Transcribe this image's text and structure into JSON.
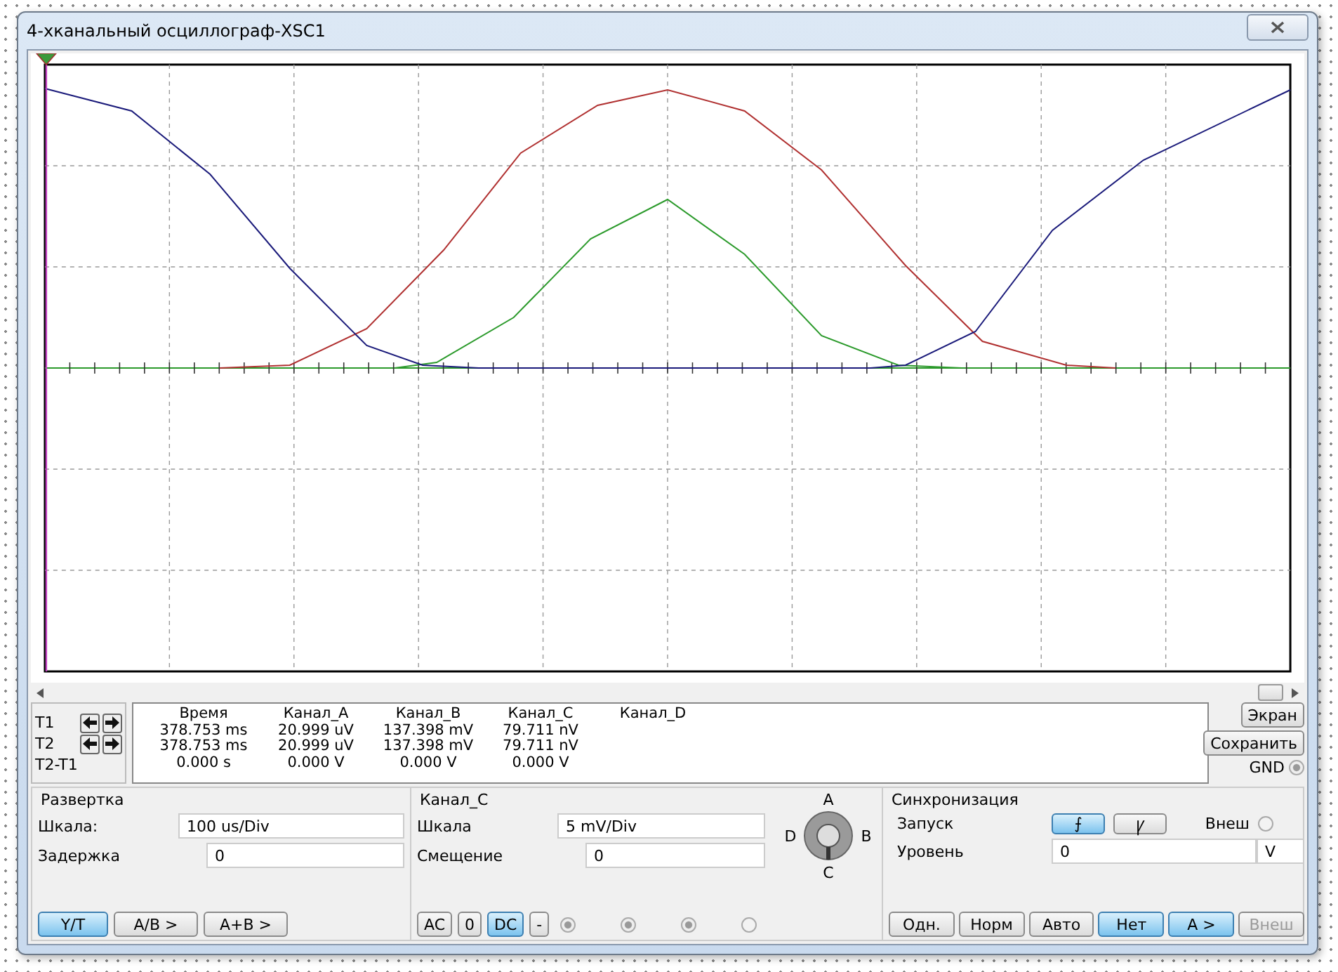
{
  "window": {
    "title": "4-хканальный осциллограф-XSC1"
  },
  "readout": {
    "row_labels": [
      "T1",
      "T2",
      "T2-T1"
    ],
    "columns": [
      {
        "header": "Время",
        "values": [
          "378.753 ms",
          "378.753 ms",
          "0.000 s"
        ]
      },
      {
        "header": "Канал_A",
        "values": [
          "20.999 uV",
          "20.999 uV",
          "0.000 V"
        ]
      },
      {
        "header": "Канал_B",
        "values": [
          "137.398 mV",
          "137.398 mV",
          "0.000 V"
        ]
      },
      {
        "header": "Канал_C",
        "values": [
          "79.711 nV",
          "79.711 nV",
          "0.000 V"
        ]
      },
      {
        "header": "Канал_D"
      }
    ]
  },
  "side": {
    "buttons": [
      "Экран",
      "Сохранить"
    ],
    "gnd_label": "GND",
    "gnd_selected": true
  },
  "timebase": {
    "title": "Развертка",
    "scale_label": "Шкала:",
    "scale_value": "100 us/Div",
    "delay_label": "Задержка",
    "delay_value": "0",
    "buttons": [
      {
        "label": "Y/T",
        "selected": true
      },
      {
        "label": "A/B >",
        "selected": false
      },
      {
        "label": "A+B >",
        "selected": false
      }
    ]
  },
  "channel": {
    "title": "Канал_C",
    "scale_label": "Шкала",
    "scale_value": "5 mV/Div",
    "offset_label": "Смещение",
    "offset_value": "0",
    "coupling": [
      {
        "label": "AC",
        "selected": false
      },
      {
        "label": "0",
        "selected": false
      },
      {
        "label": "DC",
        "selected": true
      },
      {
        "label": "-",
        "selected": false
      }
    ],
    "knob_labels": {
      "top": "A",
      "right": "B",
      "bottom": "C",
      "left": "D"
    },
    "radios": [
      {
        "selected": true
      },
      {
        "selected": true
      },
      {
        "selected": true
      },
      {
        "selected": false
      }
    ]
  },
  "trigger": {
    "title": "Синхронизация",
    "edge_label": "Запуск",
    "edges": [
      {
        "label": "⨍",
        "selected": true
      },
      {
        "label": "Ꝩ",
        "selected": false
      }
    ],
    "ext_label": "Внеш",
    "ext_selected": false,
    "level_label": "Уровень",
    "level_value": "0",
    "level_unit": "V",
    "modes": [
      {
        "label": "Одн.",
        "selected": false,
        "disabled": false
      },
      {
        "label": "Норм",
        "selected": false,
        "disabled": false
      },
      {
        "label": "Авто",
        "selected": false,
        "disabled": false
      },
      {
        "label": "Нет",
        "selected": true,
        "disabled": false
      },
      {
        "label": "A >",
        "selected": true,
        "disabled": false
      },
      {
        "label": "Внеш",
        "selected": false,
        "disabled": true
      }
    ]
  }
}
